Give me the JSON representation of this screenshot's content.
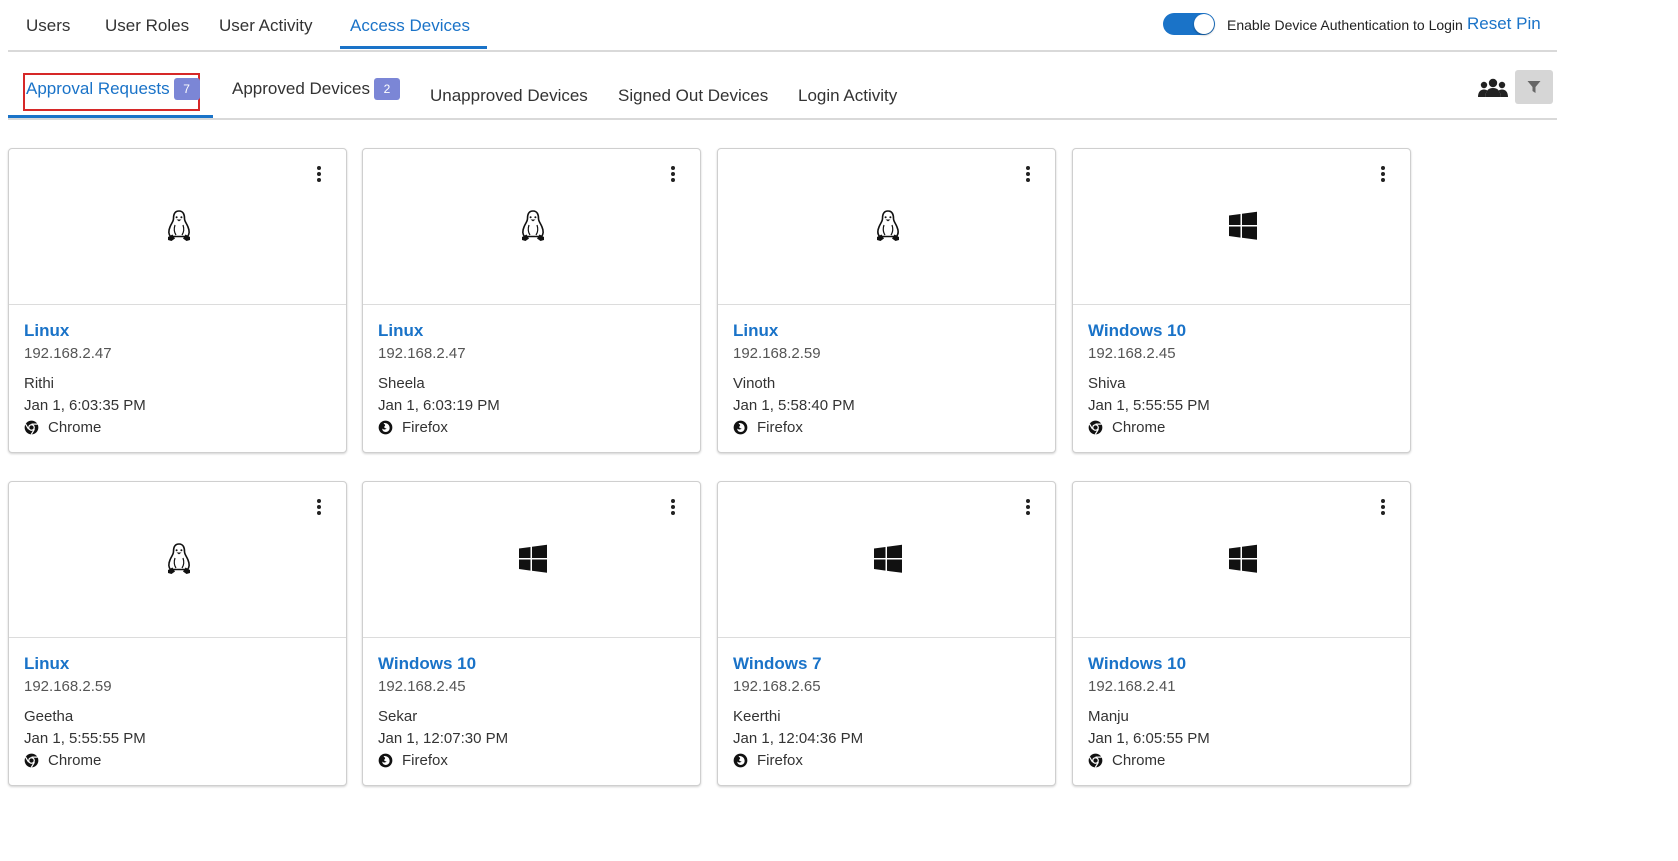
{
  "top_tabs": [
    {
      "label": "Users"
    },
    {
      "label": "User Roles"
    },
    {
      "label": "User Activity"
    },
    {
      "label": "Access Devices"
    }
  ],
  "toggle": {
    "label": "Enable Device Authentication to Login",
    "enabled": true
  },
  "reset_pin_label": "Reset Pin",
  "sub_tabs": [
    {
      "label": "Approval Requests",
      "badge": "7"
    },
    {
      "label": "Approved Devices",
      "badge": "2"
    },
    {
      "label": "Unapproved Devices"
    },
    {
      "label": "Signed Out Devices"
    },
    {
      "label": "Login Activity"
    }
  ],
  "icons": {
    "group": "users-group-icon",
    "filter": "filter-icon",
    "menu": "more-vertical-icon"
  },
  "cards": [
    {
      "os": "Linux",
      "os_icon": "linux-icon",
      "ip": "192.168.2.47",
      "user": "Rithi",
      "time": "Jan 1, 6:03:35 PM",
      "browser": "Chrome",
      "browser_icon": "chrome-icon"
    },
    {
      "os": "Linux",
      "os_icon": "linux-icon",
      "ip": "192.168.2.47",
      "user": "Sheela",
      "time": "Jan 1, 6:03:19 PM",
      "browser": "Firefox",
      "browser_icon": "firefox-icon"
    },
    {
      "os": "Linux",
      "os_icon": "linux-icon",
      "ip": "192.168.2.59",
      "user": "Vinoth",
      "time": "Jan 1, 5:58:40 PM",
      "browser": "Firefox",
      "browser_icon": "firefox-icon"
    },
    {
      "os": "Windows 10",
      "os_icon": "windows-icon",
      "ip": "192.168.2.45",
      "user": "Shiva",
      "time": "Jan 1, 5:55:55 PM",
      "browser": "Chrome",
      "browser_icon": "chrome-icon"
    },
    {
      "os": "Linux",
      "os_icon": "linux-icon",
      "ip": "192.168.2.59",
      "user": "Geetha",
      "time": "Jan 1, 5:55:55 PM",
      "browser": "Chrome",
      "browser_icon": "chrome-icon"
    },
    {
      "os": "Windows 10",
      "os_icon": "windows-icon",
      "ip": "192.168.2.45",
      "user": "Sekar",
      "time": "Jan 1, 12:07:30 PM",
      "browser": "Firefox",
      "browser_icon": "firefox-icon"
    },
    {
      "os": "Windows 7",
      "os_icon": "windows-icon",
      "ip": "192.168.2.65",
      "user": "Keerthi",
      "time": "Jan 1, 12:04:36 PM",
      "browser": "Firefox",
      "browser_icon": "firefox-icon"
    },
    {
      "os": "Windows 10",
      "os_icon": "windows-icon",
      "ip": "192.168.2.41",
      "user": "Manju",
      "time": "Jan 1, 6:05:55 PM",
      "browser": "Chrome",
      "browser_icon": "chrome-icon"
    }
  ],
  "colors": {
    "accent": "#1a73c8",
    "badge": "#7b86d6",
    "highlight_outline": "#d62828"
  }
}
